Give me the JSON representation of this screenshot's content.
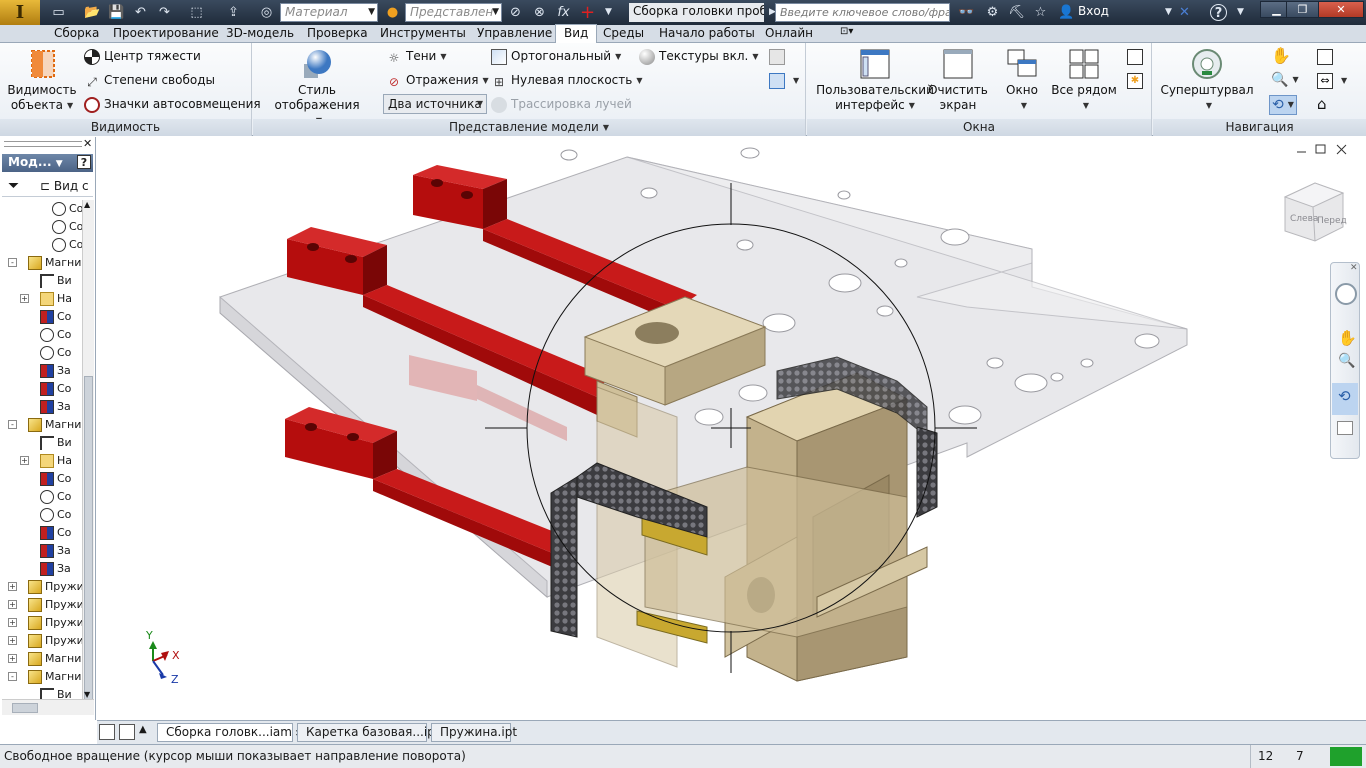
{
  "titlebar": {
    "material": "Материал",
    "representation": "Представлен",
    "fx": "fx",
    "doc_title": "Сборка головки проб...",
    "search_placeholder": "Введите ключевое слово/фразу",
    "login": "Вход",
    "help": "?"
  },
  "tabs": [
    "Сборка",
    "Проектирование",
    "3D-модель",
    "Проверка",
    "Инструменты",
    "Управление",
    "Вид",
    "Среды",
    "Начало работы",
    "Онлайн"
  ],
  "active_tab": "Вид",
  "ribbon": {
    "visibility": {
      "title": "Видимость",
      "big_label_1": "Видимость",
      "big_label_2": "объекта",
      "center_of_gravity": "Центр тяжести",
      "dof": "Степени свободы",
      "autolimit": "Значки автосовмещения"
    },
    "model_repr": {
      "title": "Представление модели",
      "style_label": "Стиль отображения",
      "shadows": "Тени",
      "reflections": "Отражения",
      "light_source": "Два источника",
      "ortho": "Ортогональный",
      "ground": "Нулевая плоскость",
      "raytrace": "Трассировка лучей",
      "textures": "Текстуры вкл."
    },
    "windows": {
      "title": "Окна",
      "ui_label_1": "Пользовательский",
      "ui_label_2": "интерфейс",
      "clean_label_1": "Очистить",
      "clean_label_2": "экран",
      "window": "Окно",
      "tile": "Все рядом"
    },
    "navigation": {
      "title": "Навигация",
      "wheel": "Суперштурвал"
    }
  },
  "browser": {
    "header": "Мод...",
    "filter_label": "Вид с",
    "rows": [
      {
        "text": "Co",
        "level": 2,
        "icon": "constraint"
      },
      {
        "text": "Co",
        "level": 2,
        "icon": "constraint"
      },
      {
        "text": "Co",
        "level": 2,
        "icon": "constraint"
      },
      {
        "text": "Магни",
        "level": 0,
        "icon": "part",
        "exp": "-"
      },
      {
        "text": "Ви",
        "level": 1,
        "icon": "view"
      },
      {
        "text": "На",
        "level": 1,
        "icon": "folder",
        "exp": "+"
      },
      {
        "text": "Co",
        "level": 1,
        "icon": "sketch"
      },
      {
        "text": "Co",
        "level": 1,
        "icon": "constraint"
      },
      {
        "text": "Co",
        "level": 1,
        "icon": "constraint"
      },
      {
        "text": "За",
        "level": 1,
        "icon": "sketch"
      },
      {
        "text": "Co",
        "level": 1,
        "icon": "sketch"
      },
      {
        "text": "За",
        "level": 1,
        "icon": "sketch"
      },
      {
        "text": "Магни",
        "level": 0,
        "icon": "part",
        "exp": "-"
      },
      {
        "text": "Ви",
        "level": 1,
        "icon": "view"
      },
      {
        "text": "На",
        "level": 1,
        "icon": "folder",
        "exp": "+"
      },
      {
        "text": "Co",
        "level": 1,
        "icon": "sketch"
      },
      {
        "text": "Co",
        "level": 1,
        "icon": "constraint"
      },
      {
        "text": "Co",
        "level": 1,
        "icon": "constraint"
      },
      {
        "text": "Co",
        "level": 1,
        "icon": "sketch"
      },
      {
        "text": "За",
        "level": 1,
        "icon": "sketch"
      },
      {
        "text": "За",
        "level": 1,
        "icon": "sketch"
      },
      {
        "text": "Пружи",
        "level": 0,
        "icon": "part",
        "exp": "+"
      },
      {
        "text": "Пружи",
        "level": 0,
        "icon": "part",
        "exp": "+"
      },
      {
        "text": "Пружи",
        "level": 0,
        "icon": "part",
        "exp": "+"
      },
      {
        "text": "Пружи",
        "level": 0,
        "icon": "part",
        "exp": "+"
      },
      {
        "text": "Магни",
        "level": 0,
        "icon": "part",
        "exp": "+"
      },
      {
        "text": "Магни",
        "level": 0,
        "icon": "part",
        "exp": "-"
      },
      {
        "text": "Ви",
        "level": 1,
        "icon": "view"
      }
    ]
  },
  "viewcube": {
    "left": "Слева",
    "front": "Перед"
  },
  "axes": {
    "x": "X",
    "y": "Y",
    "z": "Z"
  },
  "doc_tabs": [
    "Сборка головк...iam",
    "Каретка базовая...ipt",
    "Пружина.ipt"
  ],
  "status": {
    "text": "Свободное вращение (курсор мыши показывает направление поворота)",
    "num1": "12",
    "num2": "7"
  },
  "colors": {
    "accent": "#1fa12c",
    "red_part": "#9e0a0a",
    "tan_part": "#cbbd9c"
  }
}
